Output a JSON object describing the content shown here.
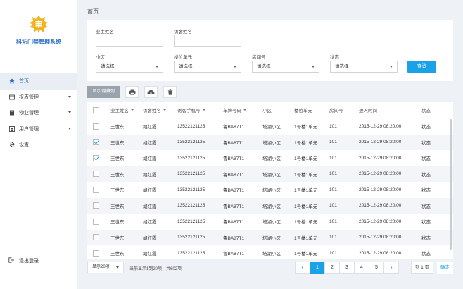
{
  "app": {
    "title": "科拓门禁管理系统",
    "accent_color": "#1aa1e6",
    "logo_color": "#f0b41d"
  },
  "sidebar": {
    "items": [
      {
        "label": "首页",
        "icon": "home-icon",
        "active": true,
        "has_submenu": false
      },
      {
        "label": "报表管理",
        "icon": "report-icon",
        "active": false,
        "has_submenu": true
      },
      {
        "label": "物业管理",
        "icon": "building-icon",
        "active": false,
        "has_submenu": true
      },
      {
        "label": "用户管理",
        "icon": "user-icon",
        "active": false,
        "has_submenu": true
      },
      {
        "label": "设置",
        "icon": "gear-icon",
        "active": false,
        "has_submenu": false
      }
    ],
    "logout_label": "退出登录"
  },
  "breadcrumb": {
    "current": "首页"
  },
  "filters": {
    "owner_name_label": "业主姓名",
    "owner_name_value": "",
    "visitor_name_label": "访客姓名",
    "visitor_name_value": "",
    "community_label": "小区",
    "community_value": "请选择",
    "building_label": "楼位单元",
    "building_value": "请选择",
    "room_label": "房间号",
    "room_value": "请选择",
    "status_label": "状态",
    "status_value": "请选择",
    "query_label": "查询"
  },
  "toolbar": {
    "toggle_columns_label": "显示/隐藏列",
    "print_icon": "printer-icon",
    "export_icon": "cloud-download-icon",
    "delete_icon": "trash-icon"
  },
  "table": {
    "columns": [
      "业主姓名",
      "访客姓名",
      "访客手机号",
      "车牌号码",
      "小区",
      "楼位单元",
      "房间号",
      "进入时间",
      "状态"
    ],
    "rows": [
      {
        "checked": false,
        "cells": [
          "王世东",
          "胡红霞",
          "13522121125",
          "鲁BA87T1",
          "塔湖小区",
          "1号楼1单元",
          "101",
          "2015-12-29 08:20:00",
          "状态"
        ]
      },
      {
        "checked": true,
        "cells": [
          "王世东",
          "胡红霞",
          "13522121125",
          "鲁BA87T1",
          "塔湖小区",
          "1号楼1单元",
          "101",
          "2015-12-29 08:20:00",
          "状态"
        ]
      },
      {
        "checked": true,
        "cells": [
          "王世东",
          "胡红霞",
          "13522121125",
          "鲁BA87T1",
          "塔湖小区",
          "1号楼1单元",
          "101",
          "2015-12-29 08:20:00",
          "状态"
        ]
      },
      {
        "checked": false,
        "cells": [
          "王世东",
          "胡红霞",
          "13522121125",
          "鲁BA87T1",
          "塔湖小区",
          "1号楼1单元",
          "101",
          "2015-12-29 08:20:00",
          "状态"
        ]
      },
      {
        "checked": false,
        "cells": [
          "王世东",
          "胡红霞",
          "13522121125",
          "鲁BA87T1",
          "塔湖小区",
          "1号楼1单元",
          "101",
          "2015-12-29 08:20:00",
          "状态"
        ]
      },
      {
        "checked": false,
        "cells": [
          "王世东",
          "胡红霞",
          "13522121125",
          "鲁BA87T1",
          "塔湖小区",
          "1号楼1单元",
          "101",
          "2015-12-29 08:20:00",
          "状态"
        ]
      },
      {
        "checked": false,
        "cells": [
          "王世东",
          "胡红霞",
          "13522121125",
          "鲁BA87T1",
          "塔湖小区",
          "1号楼1单元",
          "101",
          "2015-12-29 08:20:00",
          "状态"
        ]
      },
      {
        "checked": false,
        "cells": [
          "王世东",
          "胡红霞",
          "13522121125",
          "鲁BA87T1",
          "塔湖小区",
          "1号楼1单元",
          "101",
          "2015-12-29 08:20:00",
          "状态"
        ]
      },
      {
        "checked": false,
        "cells": [
          "王世东",
          "胡红霞",
          "13522121125",
          "鲁BA87T1",
          "塔湖小区",
          "1号楼1单元",
          "101",
          "2015-12-29 08:20:00",
          "状态"
        ]
      }
    ]
  },
  "pagination": {
    "page_size_label": "显示20项",
    "summary": "当前显示1到20项，共602项",
    "pages": [
      "1",
      "2",
      "3",
      "4",
      "5"
    ],
    "current_page": "1",
    "prev_symbol": "‹",
    "next_symbol": "›",
    "goto_label": "到 1 页",
    "confirm_label": "确定"
  }
}
